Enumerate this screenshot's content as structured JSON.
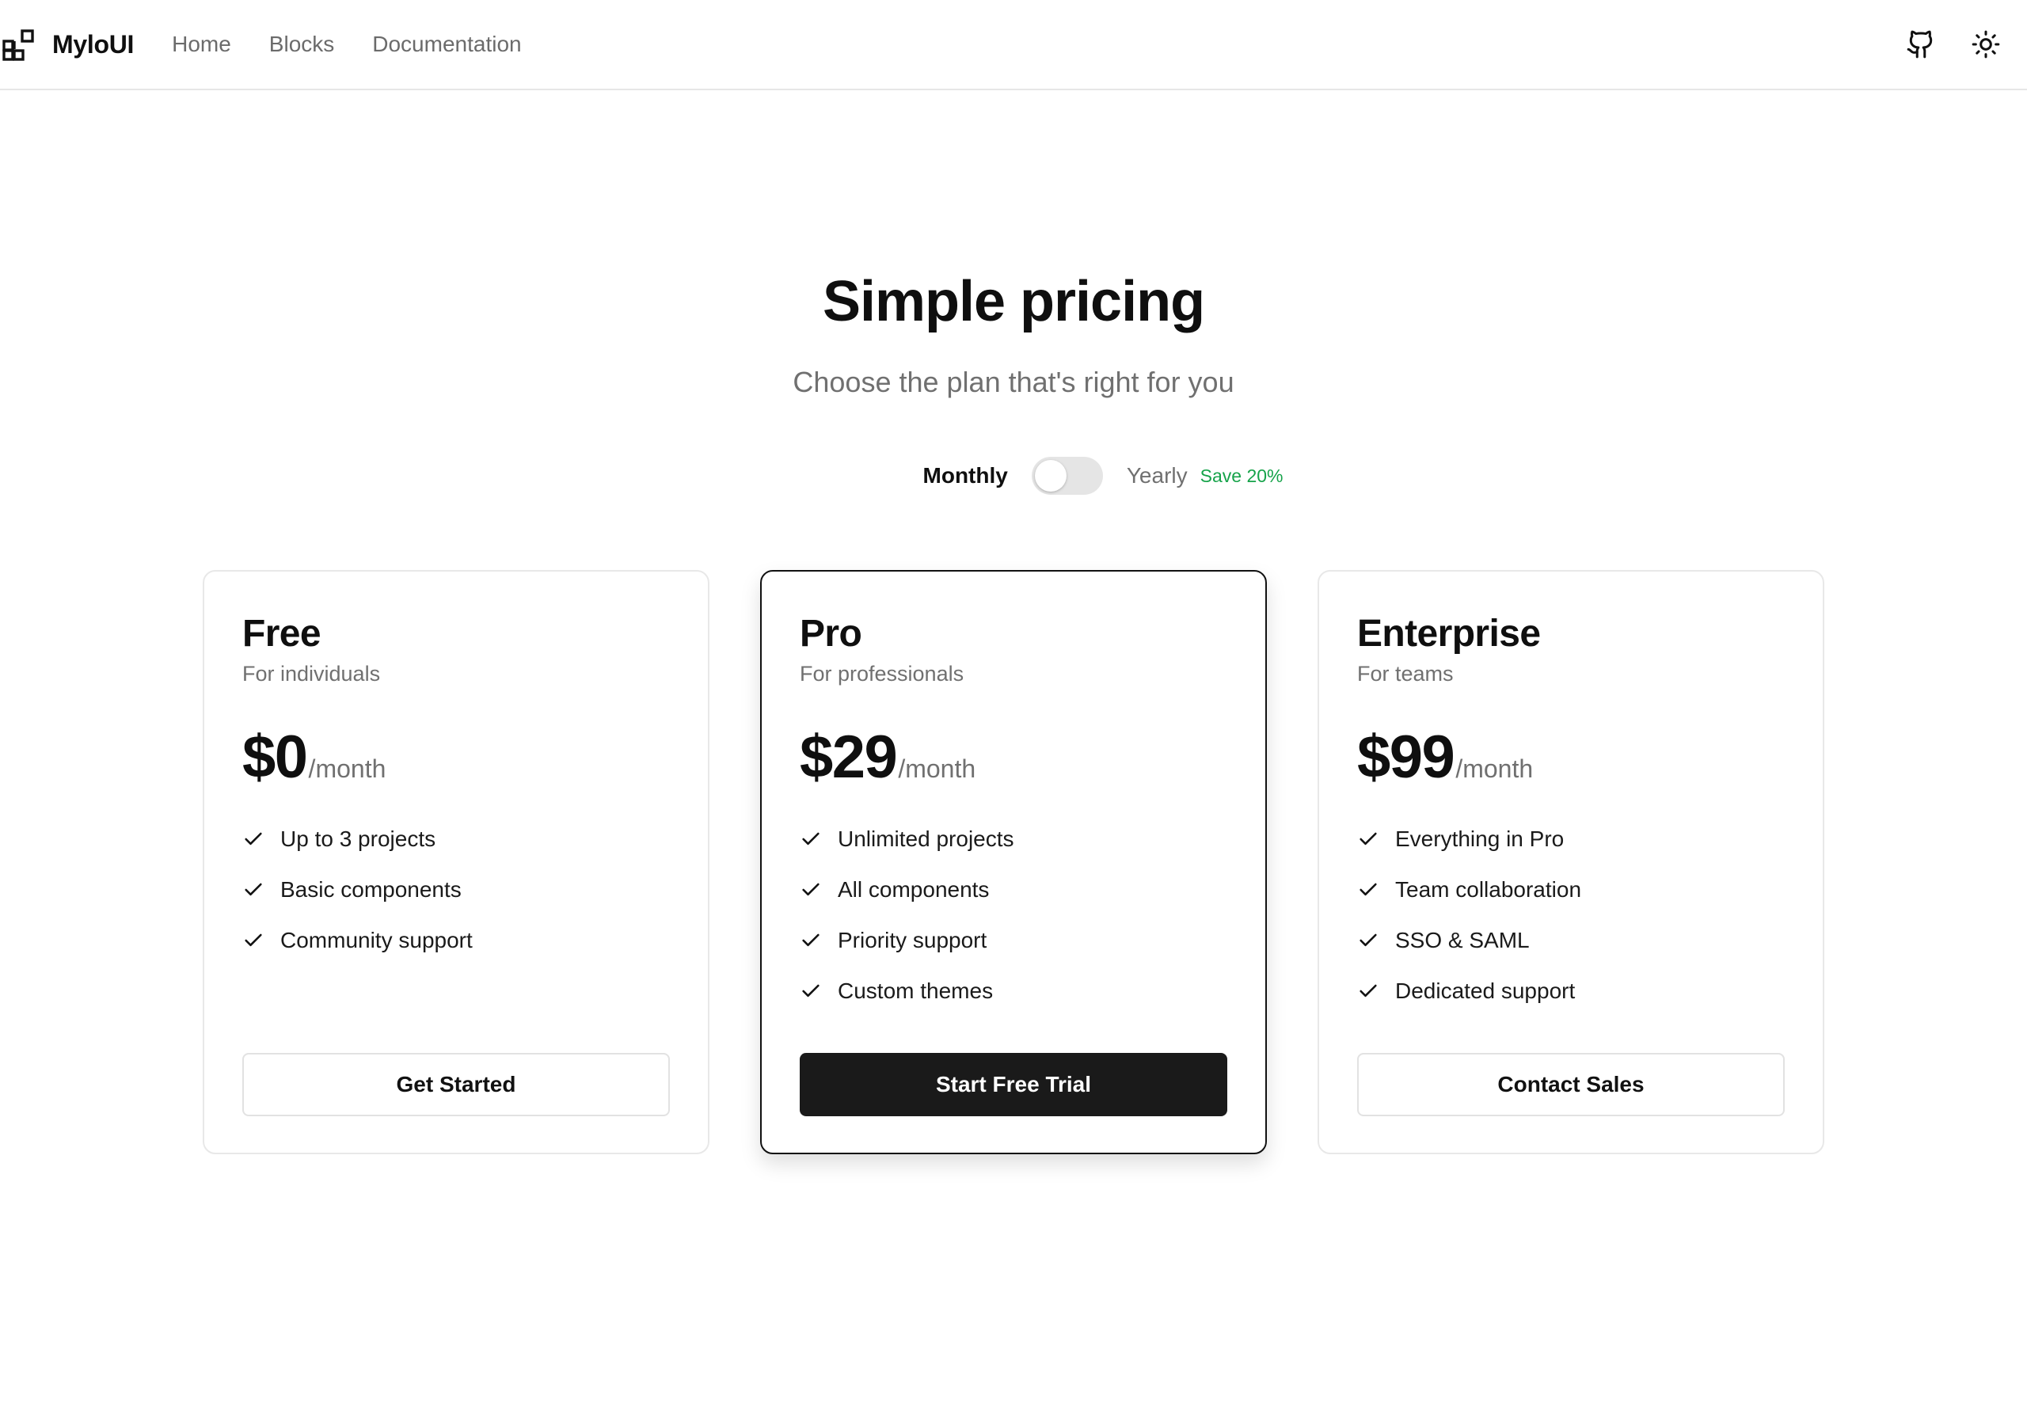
{
  "header": {
    "brand": "MyloUI",
    "nav": [
      "Home",
      "Blocks",
      "Documentation"
    ],
    "actions": [
      {
        "icon": "github-icon"
      },
      {
        "icon": "sun-icon"
      }
    ]
  },
  "hero": {
    "title": "Simple pricing",
    "subtitle": "Choose the plan that's right for you"
  },
  "billing": {
    "monthly_label": "Monthly",
    "yearly_label": "Yearly",
    "save_badge": "Save 20%",
    "yearly_selected": false,
    "save_color": "#16a34a"
  },
  "plans": [
    {
      "name": "Free",
      "description": "For individuals",
      "price": "$0",
      "period": "/month",
      "features": [
        "Up to 3 projects",
        "Basic components",
        "Community support"
      ],
      "cta": "Get Started",
      "featured": false
    },
    {
      "name": "Pro",
      "description": "For professionals",
      "price": "$29",
      "period": "/month",
      "features": [
        "Unlimited projects",
        "All components",
        "Priority support",
        "Custom themes"
      ],
      "cta": "Start Free Trial",
      "featured": true
    },
    {
      "name": "Enterprise",
      "description": "For teams",
      "price": "$99",
      "period": "/month",
      "features": [
        "Everything in Pro",
        "Team collaboration",
        "SSO & SAML",
        "Dedicated support"
      ],
      "cta": "Contact Sales",
      "featured": false
    }
  ],
  "colors": {
    "text": "#0f0f0f",
    "muted": "#707070",
    "border": "#e8e8e8",
    "primary_button": "#1a1a1a"
  }
}
